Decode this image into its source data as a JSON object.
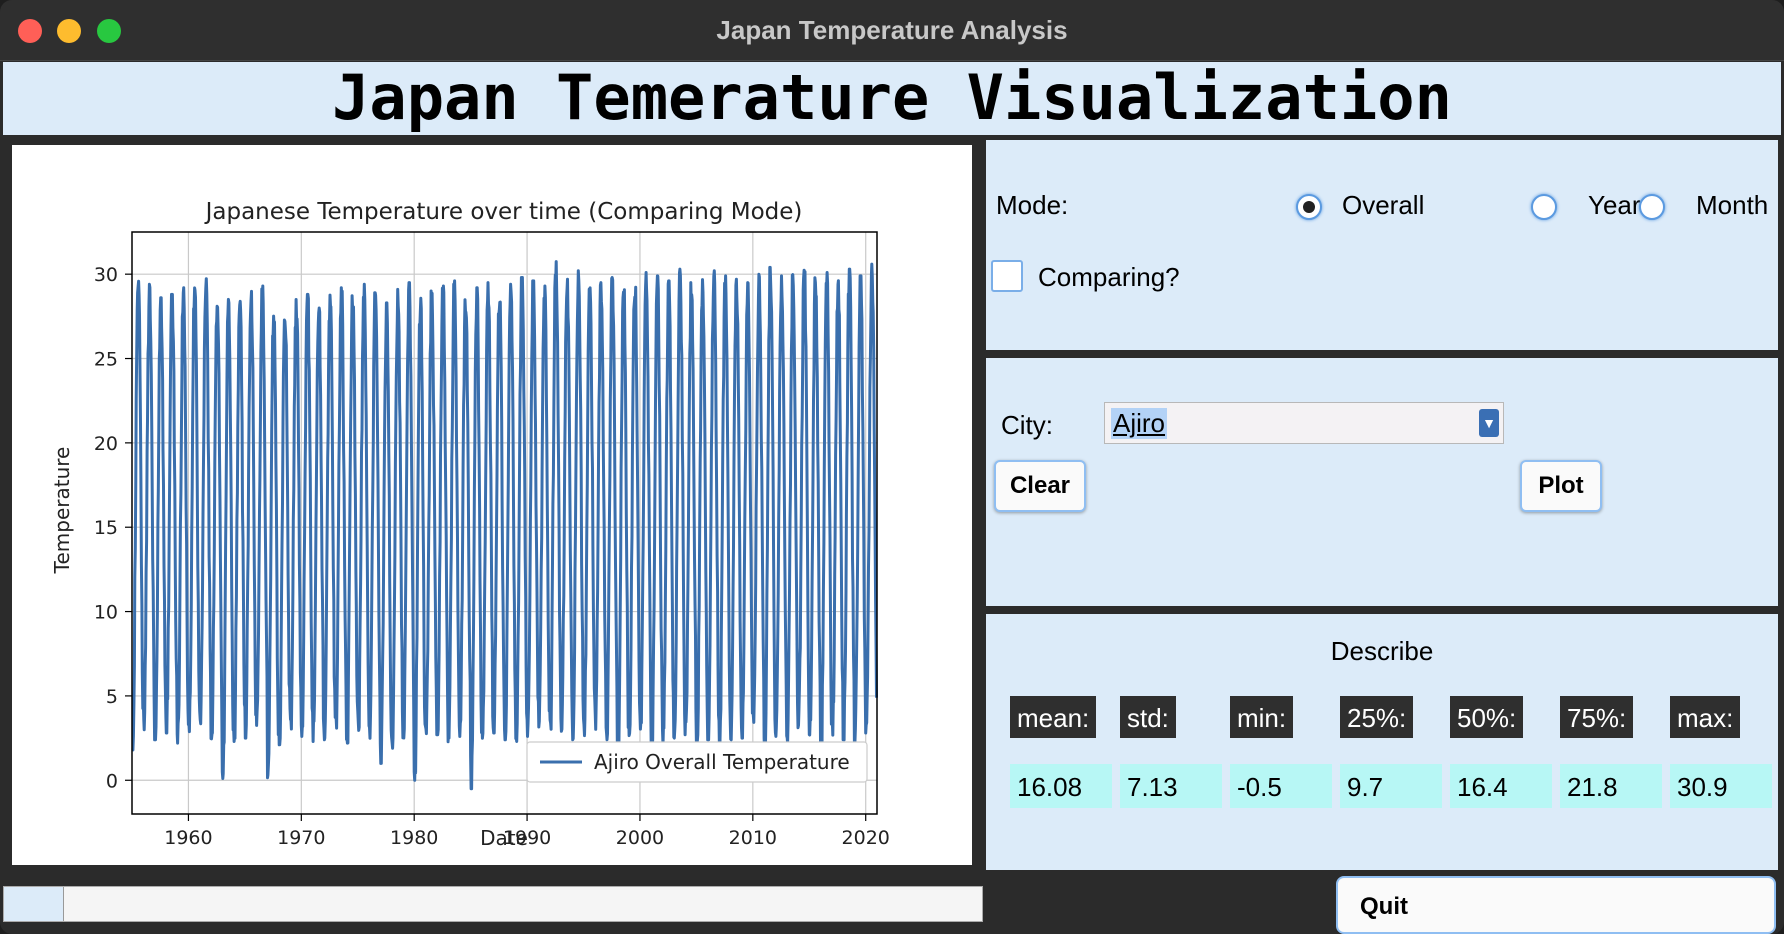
{
  "window": {
    "title": "Japan Temperature Analysis"
  },
  "header": {
    "title": "Japan Temerature Visualization"
  },
  "chart_data": {
    "type": "line",
    "title": "Japanese Temperature over time (Comparing Mode)",
    "xlabel": "Date",
    "ylabel": "Temperature",
    "xlim": [
      1955,
      2021
    ],
    "ylim": [
      -2,
      32.5
    ],
    "xticks": [
      "1960",
      "1970",
      "1980",
      "1990",
      "2000",
      "2010",
      "2020"
    ],
    "yticks": [
      "0",
      "5",
      "10",
      "15",
      "20",
      "25",
      "30"
    ],
    "grid": true,
    "legend_position": "lower right",
    "series": [
      {
        "name": "Ajiro Overall Temperature",
        "color": "#3a6fad",
        "x_start": 1955,
        "x_end": 2021,
        "cycle_years": 1,
        "annual_max": [
          29.8,
          29.4,
          28.6,
          28.8,
          29.2,
          29.3,
          29.8,
          29.0,
          28.7,
          29.1,
          29.2,
          29.3,
          28.2,
          27.9,
          28.5,
          28.8,
          28.4,
          29.0,
          29.2,
          28.8,
          29.4,
          28.9,
          28.3,
          29.1,
          29.5,
          28.6,
          29.0,
          29.3,
          29.6,
          28.9,
          29.2,
          29.5,
          29.0,
          29.4,
          29.8,
          29.6,
          29.3,
          30.9,
          29.7,
          30.2,
          30.0,
          29.5,
          29.8,
          29.3,
          29.7,
          30.1,
          29.9,
          29.6,
          30.3,
          29.5,
          29.8,
          30.2,
          29.9,
          29.7,
          29.5,
          30.0,
          30.4,
          29.9,
          30.2,
          30.5,
          29.8,
          30.1,
          29.7,
          30.3,
          29.9,
          30.6
        ],
        "annual_min": [
          1.8,
          3.0,
          2.4,
          2.8,
          2.2,
          2.6,
          3.0,
          2.4,
          0.0,
          2.2,
          2.5,
          3.0,
          0.0,
          2.1,
          2.8,
          2.6,
          2.3,
          2.4,
          2.6,
          2.0,
          2.7,
          2.3,
          1.0,
          1.9,
          2.5,
          0.0,
          2.4,
          2.7,
          2.2,
          2.6,
          -0.5,
          2.3,
          2.8,
          2.4,
          2.3,
          2.6,
          2.8,
          2.5,
          2.9,
          2.4,
          2.6,
          3.0,
          2.4,
          1.3,
          2.6,
          2.3,
          1.6,
          2.1,
          2.5,
          2.7,
          1.8,
          2.4,
          2.0,
          2.4,
          2.5,
          2.9,
          1.7,
          2.6,
          2.2,
          3.0,
          2.6,
          1.5,
          2.5,
          2.4,
          2.2,
          2.8
        ]
      }
    ]
  },
  "controls": {
    "mode_label": "Mode:",
    "modes": [
      {
        "label": "Overall",
        "selected": true
      },
      {
        "label": "Year",
        "selected": false
      },
      {
        "label": "Month",
        "selected": false
      }
    ],
    "comparing_label": "Comparing?",
    "comparing_checked": false,
    "city_label": "City:",
    "city_value": "Ajiro",
    "clear_label": "Clear",
    "plot_label": "Plot"
  },
  "describe": {
    "title": "Describe",
    "stats": [
      {
        "label": "mean:",
        "value": "16.08"
      },
      {
        "label": "std:",
        "value": "7.13"
      },
      {
        "label": "min:",
        "value": "-0.5"
      },
      {
        "label": "25%:",
        "value": "9.7"
      },
      {
        "label": "50%:",
        "value": "16.4"
      },
      {
        "label": "75%:",
        "value": "21.8"
      },
      {
        "label": "max:",
        "value": "30.9"
      }
    ]
  },
  "progress": {
    "fraction": 0.06
  },
  "quit_label": "Quit"
}
